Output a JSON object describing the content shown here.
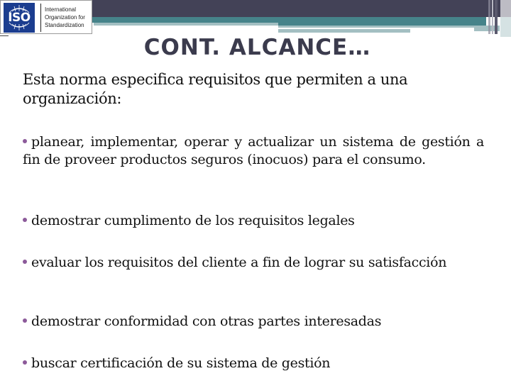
{
  "header": {
    "logo": {
      "mark_text": "ISO",
      "org_lines": [
        "International",
        "Organization for",
        "Standardization"
      ],
      "icon": "iso-globe-logo-icon"
    },
    "colors": {
      "band_dark": "#434257",
      "band_teal": "#46838a",
      "band_light": "#a3bfc2",
      "logo_blue": "#1b3d8f",
      "bullet": "#8c5a9a",
      "title": "#3b3b4d"
    }
  },
  "slide": {
    "title": "CONT. ALCANCE…",
    "intro": "Esta norma especifica requisitos que permiten a una organización:",
    "bullets": [
      "planear, implementar, operar y actualizar un sistema de gestión a fin de proveer productos seguros (inocuos) para el consumo.",
      "demostrar cumplimento de los requisitos legales",
      "evaluar los requisitos del cliente a fin de lograr su satisfacción",
      "demostrar conformidad con otras partes interesadas",
      "buscar certificación de su sistema de gestión"
    ]
  }
}
